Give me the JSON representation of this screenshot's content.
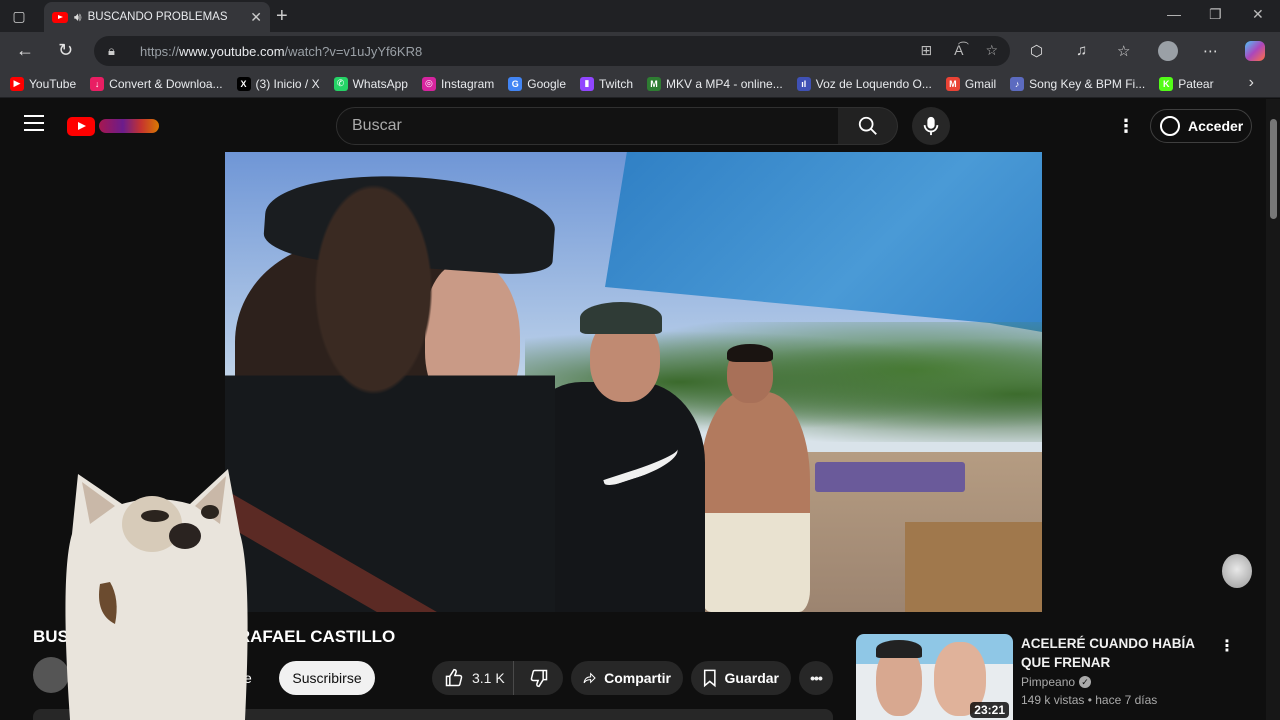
{
  "browser": {
    "tab_title": "BUSCANDO PROBLEMAS EN",
    "url_prefix": "https://",
    "url_host": "www.youtube.com",
    "url_path": "/watch?v=v1uJyYf6KR8",
    "bookmarks": [
      {
        "label": "YouTube",
        "color": "#ff0000",
        "glyph": "▶"
      },
      {
        "label": "Convert & Downloa...",
        "color": "#e91e63",
        "glyph": "↓"
      },
      {
        "label": "(3) Inicio / X",
        "color": "#000000",
        "glyph": "X"
      },
      {
        "label": "WhatsApp",
        "color": "#25d366",
        "glyph": "✆"
      },
      {
        "label": "Instagram",
        "color": "#d6249f",
        "glyph": "◎"
      },
      {
        "label": "Google",
        "color": "#4285f4",
        "glyph": "G"
      },
      {
        "label": "Twitch",
        "color": "#9146ff",
        "glyph": "▮"
      },
      {
        "label": "MKV a MP4 - online...",
        "color": "#2e7d32",
        "glyph": "M"
      },
      {
        "label": "Voz de Loquendo O...",
        "color": "#3f51b5",
        "glyph": "ıl"
      },
      {
        "label": "Gmail",
        "color": "#ea4335",
        "glyph": "M"
      },
      {
        "label": "Song Key & BPM Fi...",
        "color": "#5c6bc0",
        "glyph": "♪"
      },
      {
        "label": "Patear",
        "color": "#53fc18",
        "glyph": "K"
      }
    ]
  },
  "youtube": {
    "search_placeholder": "Buscar",
    "signin_label": "Acceder",
    "video_title": "BUSCANDO PROBLEMAS EN RAFAEL CASTILLO",
    "visible_title_start": "BUSCA",
    "visible_title_end": "S EN RAFAEL CASTILLO",
    "subscribe_label": "Suscribirse",
    "partial_text": "se",
    "like_count": "3.1 K",
    "share_label": "Compartir",
    "save_label": "Guardar"
  },
  "recommendation": {
    "title": "ACELERÉ CUANDO HABÍA QUE FRENAR",
    "channel": "Pimpeano",
    "meta": "149 k vistas • hace 7 días",
    "duration": "23:21"
  },
  "colors": {
    "youtube_red": "#ff0000",
    "page_bg": "#0f0f0f"
  }
}
